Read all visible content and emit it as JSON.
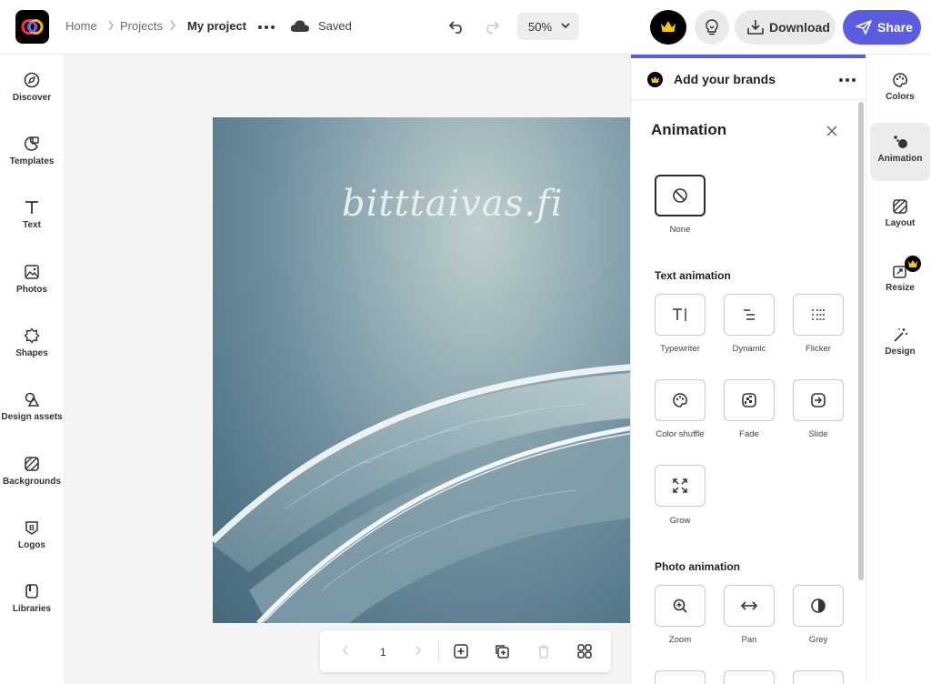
{
  "topbar": {
    "breadcrumb": [
      "Home",
      "Projects",
      "My project"
    ],
    "save_status": "Saved",
    "zoom": "50%",
    "download_label": "Download",
    "share_label": "Share"
  },
  "left_sidebar": {
    "items": [
      {
        "label": "Discover",
        "icon": "compass-icon"
      },
      {
        "label": "Templates",
        "icon": "templates-icon"
      },
      {
        "label": "Text",
        "icon": "text-icon"
      },
      {
        "label": "Photos",
        "icon": "photo-icon"
      },
      {
        "label": "Shapes",
        "icon": "shapes-icon"
      },
      {
        "label": "Design assets",
        "icon": "design-assets-icon"
      },
      {
        "label": "Backgrounds",
        "icon": "backgrounds-icon"
      },
      {
        "label": "Logos",
        "icon": "logo-icon"
      },
      {
        "label": "Libraries",
        "icon": "libraries-icon"
      }
    ]
  },
  "canvas": {
    "wordmark": "bitttaivas.fi",
    "page_number": "1"
  },
  "panel": {
    "brands_label": "Add your brands",
    "title": "Animation",
    "none_label": "None",
    "text_section": "Text animation",
    "text_items": [
      "Typewriter",
      "Dynamic",
      "Flicker",
      "Color shuffle",
      "Fade",
      "Slide",
      "Grow"
    ],
    "photo_section": "Photo animation",
    "photo_items": [
      "Zoom",
      "Pan",
      "Grey"
    ]
  },
  "right_rail": {
    "items": [
      "Colors",
      "Animation",
      "Layout",
      "Resize",
      "Design"
    ],
    "active": "Animation"
  },
  "colors": {
    "accent": "#5c5ce0",
    "premium": "#f5c518"
  }
}
